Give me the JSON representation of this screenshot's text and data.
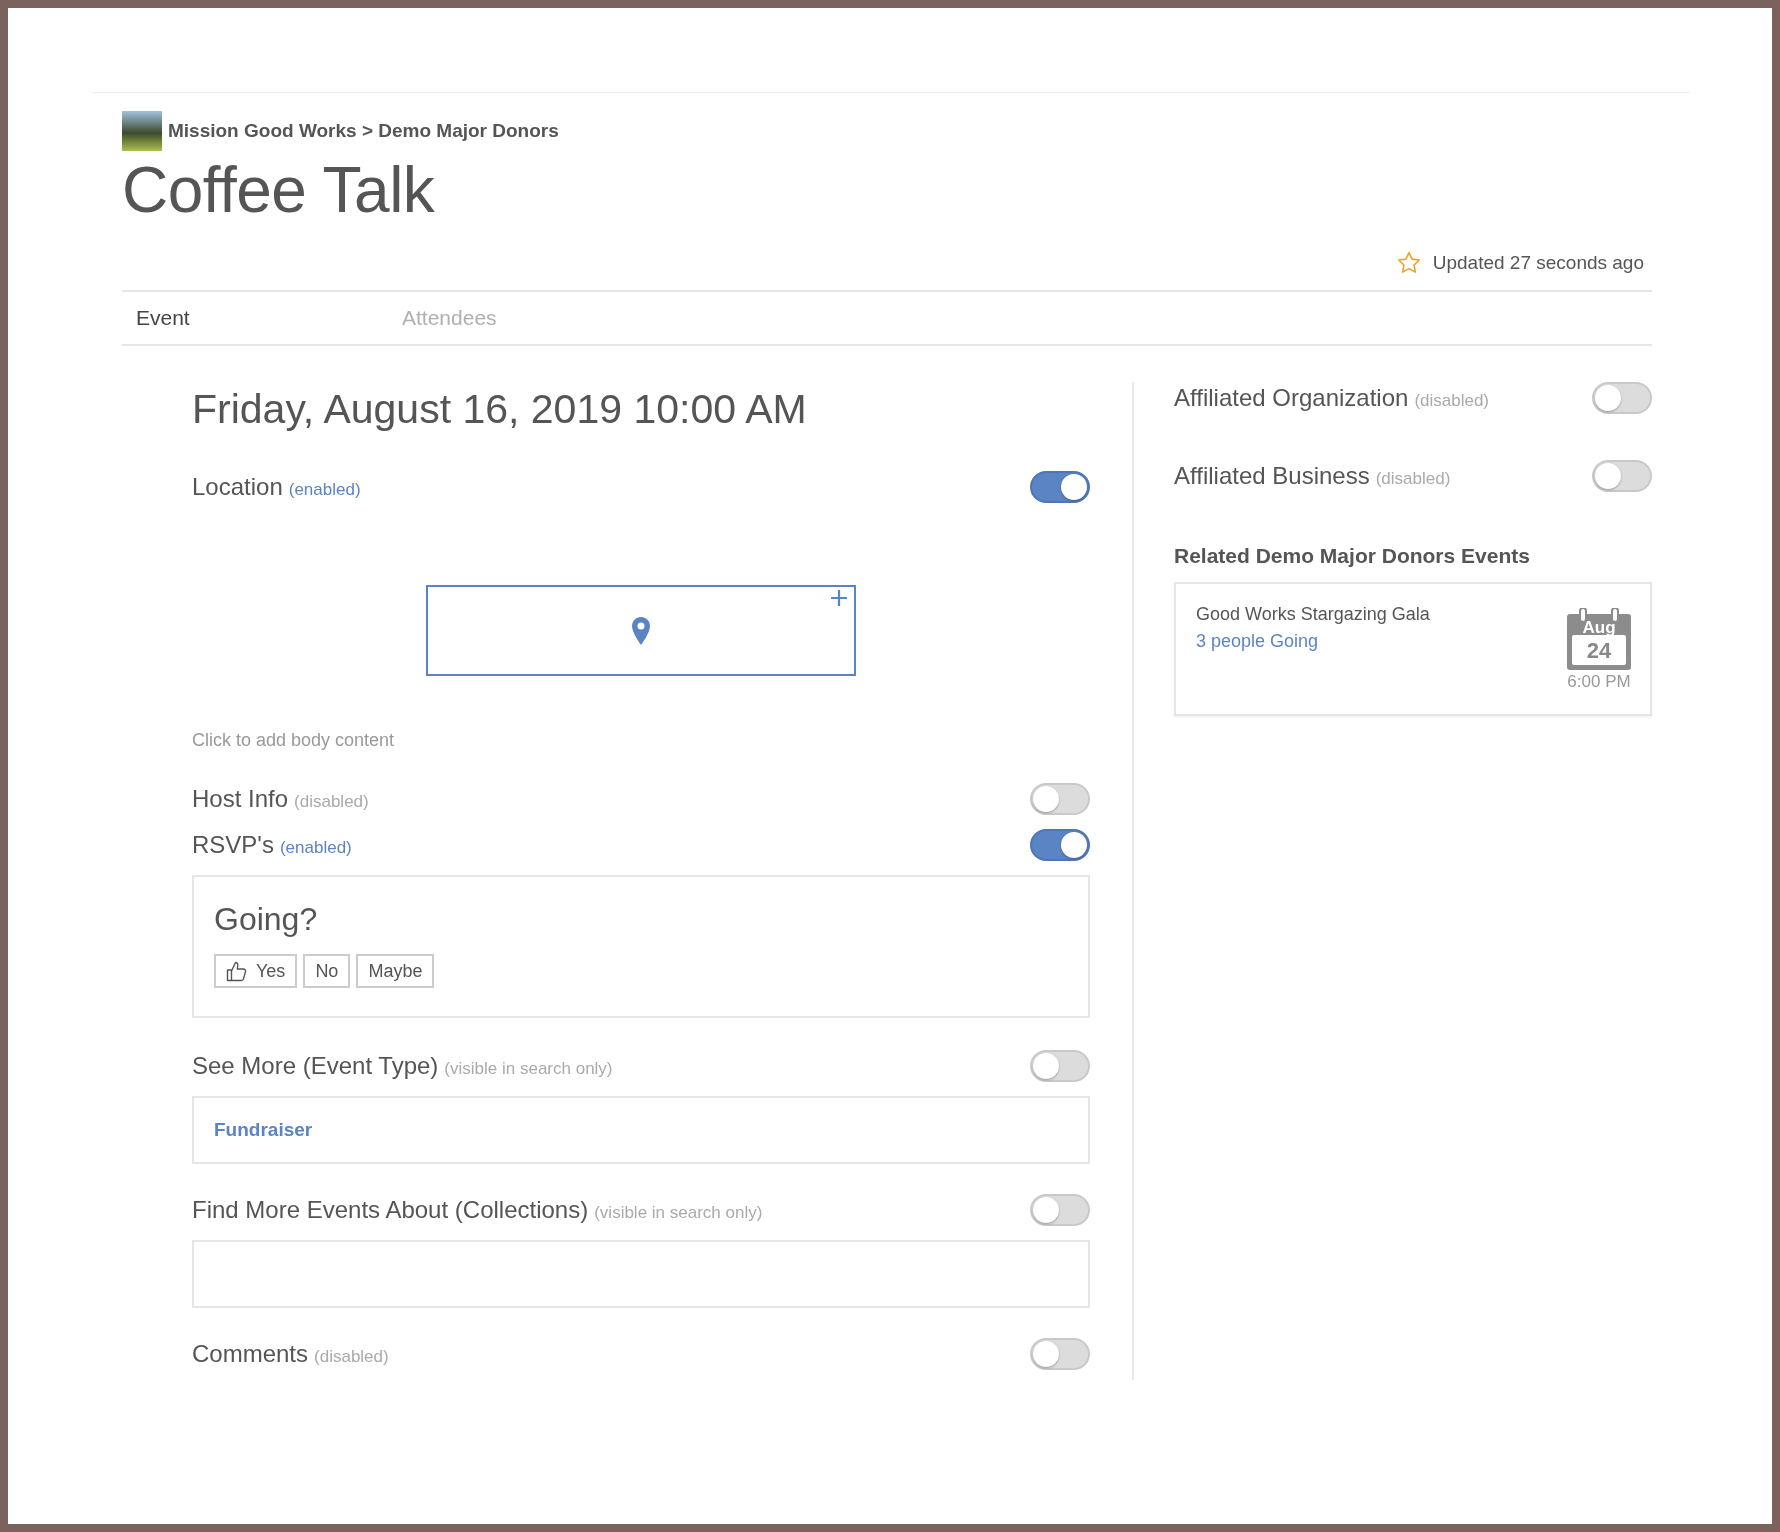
{
  "breadcrumb": {
    "text": "Mission Good Works > Demo Major Donors"
  },
  "title": "Coffee Talk",
  "updated": {
    "text": "Updated 27 seconds ago",
    "starred": false
  },
  "tabs": [
    {
      "label": "Event",
      "selected": true
    },
    {
      "label": "Attendees",
      "selected": false
    }
  ],
  "event": {
    "date": "Friday, August 16, 2019 10:00 AM",
    "sections": [
      {
        "kind": "toggle",
        "label": "Location",
        "status": "(enabled)",
        "on": true
      },
      {
        "kind": "map"
      },
      {
        "kind": "body",
        "placeholder": "Click to add body content"
      },
      {
        "kind": "toggle",
        "label": "Host Info",
        "status": "(disabled)",
        "on": false
      },
      {
        "kind": "toggle",
        "label": "RSVP's",
        "status": "(enabled)",
        "on": true
      },
      {
        "kind": "rsvp",
        "question": "Going?",
        "options": [
          "Yes",
          "No",
          "Maybe"
        ]
      },
      {
        "kind": "toggle",
        "label": "See More (Event Type)",
        "status": "(visible in search only)",
        "on": false
      },
      {
        "kind": "tags",
        "tags": [
          "Fundraiser"
        ]
      },
      {
        "kind": "toggle",
        "label": "Find More Events About (Collections)",
        "status": "(visible in search only)",
        "on": false
      },
      {
        "kind": "tags"
      },
      {
        "kind": "toggle",
        "label": "Comments",
        "status": "(disabled)",
        "on": false
      }
    ]
  },
  "sidebar": {
    "toggles": [
      {
        "label": "Affiliated Organization",
        "status": "(disabled)",
        "on": false
      },
      {
        "label": "Affiliated Business",
        "status": "(disabled)",
        "on": false
      }
    ],
    "related_heading": "Related Demo Major Donors Events",
    "related_events": [
      {
        "title": "Good Works Stargazing Gala",
        "going": "3 people Going",
        "month": "Aug",
        "day": "24",
        "time": "6:00 PM"
      }
    ]
  }
}
